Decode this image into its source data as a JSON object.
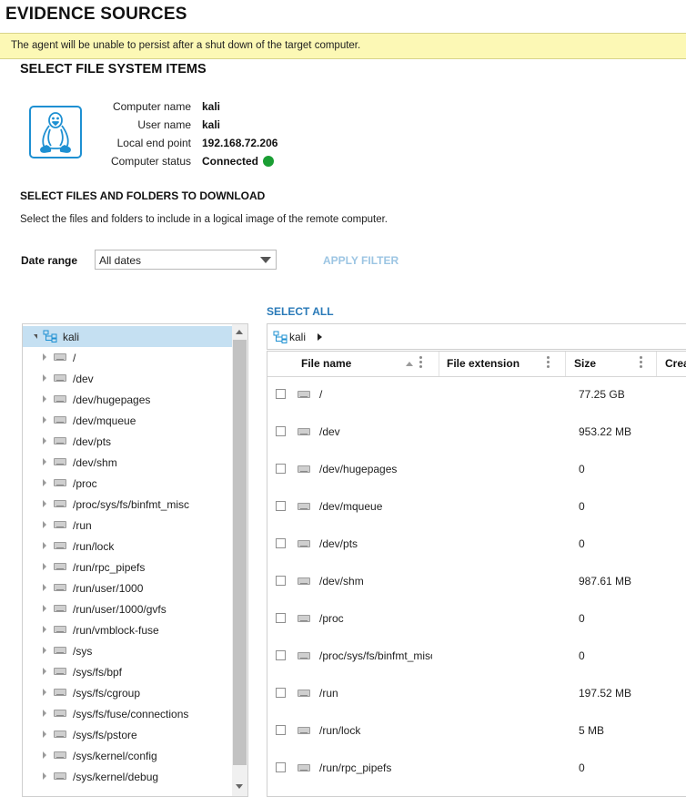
{
  "page": {
    "title": "EVIDENCE SOURCES",
    "warning": "The agent will be unable to persist after a shut down of the target computer."
  },
  "section": {
    "title": "SELECT FILE SYSTEM ITEMS"
  },
  "computer": {
    "os_icon": "linux-penguin-icon",
    "fields": [
      {
        "label": "Computer name",
        "value": "kali"
      },
      {
        "label": "User name",
        "value": "kali"
      },
      {
        "label": "Local end point",
        "value": "192.168.72.206"
      },
      {
        "label": "Computer status",
        "value": "Connected"
      }
    ],
    "status_color": "#1a9e33"
  },
  "download": {
    "title": "SELECT FILES AND FOLDERS TO DOWNLOAD",
    "description": "Select the files and folders to include in a logical image of the remote computer."
  },
  "filter": {
    "date_label": "Date range",
    "date_value": "All dates",
    "apply_label": "APPLY FILTER"
  },
  "select_all_label": "SELECT ALL",
  "tree": {
    "root": "kali",
    "items": [
      "/",
      "/dev",
      "/dev/hugepages",
      "/dev/mqueue",
      "/dev/pts",
      "/dev/shm",
      "/proc",
      "/proc/sys/fs/binfmt_misc",
      "/run",
      "/run/lock",
      "/run/rpc_pipefs",
      "/run/user/1000",
      "/run/user/1000/gvfs",
      "/run/vmblock-fuse",
      "/sys",
      "/sys/fs/bpf",
      "/sys/fs/cgroup",
      "/sys/fs/fuse/connections",
      "/sys/fs/pstore",
      "/sys/kernel/config",
      "/sys/kernel/debug"
    ]
  },
  "breadcrumb": {
    "label": "kali"
  },
  "table": {
    "columns": {
      "name": "File name",
      "extension": "File extension",
      "size": "Size",
      "created": "Crea"
    },
    "rows": [
      {
        "name": "/",
        "size": "77.25 GB"
      },
      {
        "name": "/dev",
        "size": "953.22 MB"
      },
      {
        "name": "/dev/hugepages",
        "size": "0"
      },
      {
        "name": "/dev/mqueue",
        "size": "0"
      },
      {
        "name": "/dev/pts",
        "size": "0"
      },
      {
        "name": "/dev/shm",
        "size": "987.61 MB"
      },
      {
        "name": "/proc",
        "size": "0"
      },
      {
        "name": "/proc/sys/fs/binfmt_misc",
        "size": "0"
      },
      {
        "name": "/run",
        "size": "197.52 MB"
      },
      {
        "name": "/run/lock",
        "size": "5 MB"
      },
      {
        "name": "/run/rpc_pipefs",
        "size": "0"
      }
    ]
  },
  "colors": {
    "warning_bg": "#fcf8b5",
    "selected_bg": "#c5e0f2",
    "link": "#2a7ab8",
    "link_disabled": "#9cc5e3",
    "icon_blue": "#1e90d2"
  }
}
